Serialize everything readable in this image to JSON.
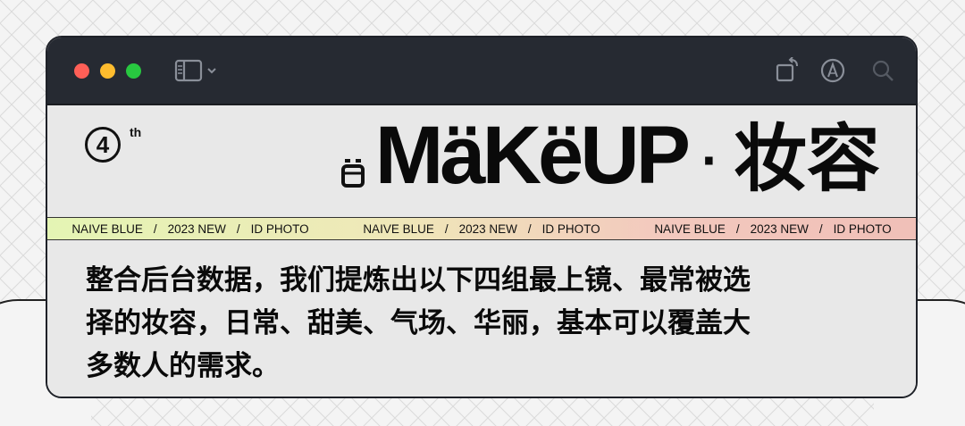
{
  "window": {
    "controls": [
      "close",
      "minimize",
      "maximize"
    ],
    "toolbar_icons": [
      "sidebar-icon",
      "chevron-down-icon",
      "rotate-icon",
      "markup-icon",
      "search-icon"
    ]
  },
  "badge": {
    "number": "4",
    "suffix": "th"
  },
  "title": {
    "english": "MäKëUP",
    "separator": "·",
    "chinese": "妆容"
  },
  "ticker": [
    {
      "brand": "NAIVE BLUE",
      "sep1": "/",
      "year": "2023  NEW",
      "sep2": "/",
      "type": "ID  PHOTO"
    },
    {
      "brand": "NAIVE BLUE",
      "sep1": "/",
      "year": "2023  NEW",
      "sep2": "/",
      "type": "ID  PHOTO"
    },
    {
      "brand": "NAIVE BLUE",
      "sep1": "/",
      "year": "2023  NEW",
      "sep2": "/",
      "type": "ID  PHOTO"
    }
  ],
  "description": {
    "line1": "整合后台数据，我们提炼出以下四组最上镜、最常被选",
    "line2": "择的妆容，日常、甜美、气场、华丽，基本可以覆盖大",
    "line3": "多数人的需求。"
  },
  "colors": {
    "titlebar": "#262a32",
    "close": "#fe5f57",
    "minimize": "#febc2e",
    "maximize": "#28c840",
    "ticker_start": "#e4f5b4",
    "ticker_end": "#f0bfb7"
  }
}
